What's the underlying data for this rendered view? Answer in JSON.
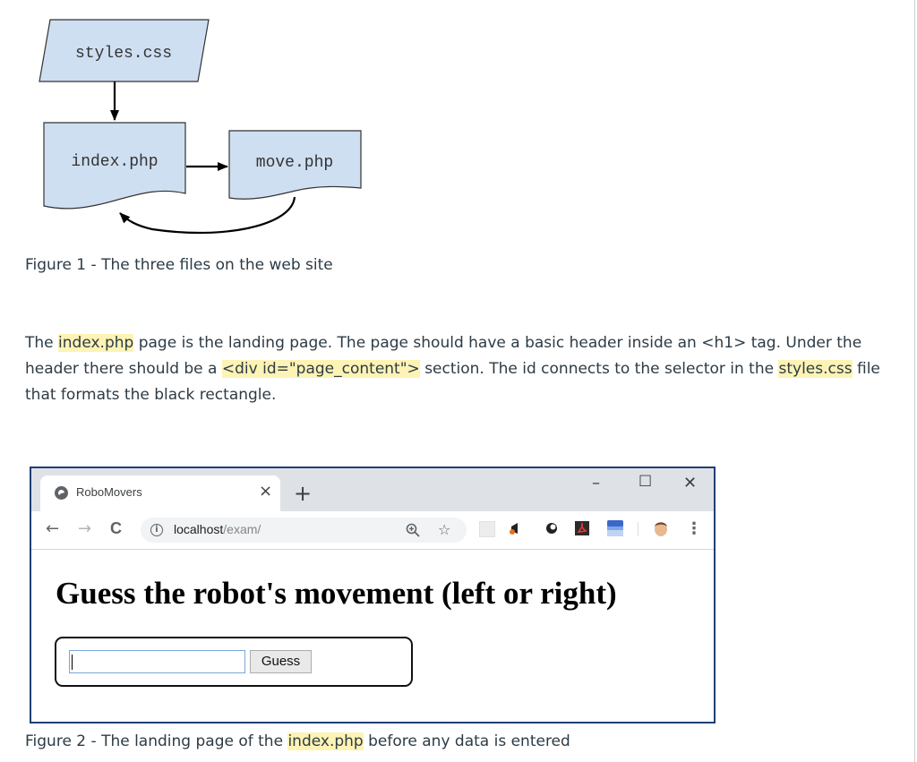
{
  "figure1": {
    "nodes": {
      "styles": "styles.css",
      "index": "index.php",
      "move": "move.php"
    },
    "caption": "Figure 1 - The three files on the web site"
  },
  "paragraph": {
    "t1": "The ",
    "h1": "index.php",
    "t2": " page is the landing page. The page should have a basic header inside an <h1> tag. Under the header there should be a ",
    "h2": "<div id=\"page_content\">",
    "t3": " section. The id connects to the selector in the ",
    "h3": "styles.css",
    "t4": " file that formats the black rectangle."
  },
  "figure2": {
    "browser": {
      "tab_title": "RoboMovers",
      "tab_close": "×",
      "new_tab": "+",
      "minimize": "–",
      "maximize": "☐",
      "close": "✕",
      "back": "←",
      "forward": "→",
      "reload": "C",
      "info": "i",
      "url_host": "localhost",
      "url_path": "/exam/",
      "zoom_icon": "zoom-icon",
      "star": "☆",
      "menu": "⋮"
    },
    "page": {
      "heading": "Guess the robot's movement (left or right)",
      "input_value": "",
      "button_label": "Guess"
    },
    "caption_pre": "Figure 2 - The landing page of the ",
    "caption_hl": "index.php",
    "caption_post": " before any data is entered"
  },
  "colors": {
    "node_fill": "#cfdff2",
    "highlight": "#fdf3b5",
    "browser_border": "#1f3f74"
  }
}
